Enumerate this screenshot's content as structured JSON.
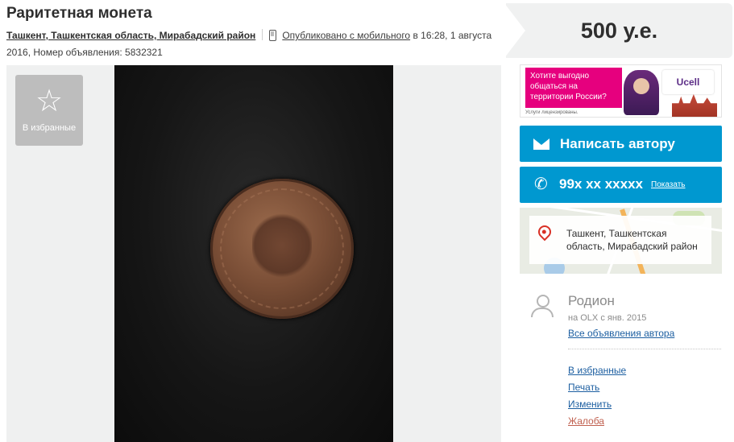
{
  "listing": {
    "title": "Раритетная монета",
    "location": "Ташкент, Ташкентская область, Мирабадский район",
    "published_mobile": "Опубликовано с мобильного",
    "published_time": " в 16:28, 1 августа 2016, Номер объявления: 5832321"
  },
  "gallery": {
    "favorite_label": "В избранные",
    "favorite_icon": "star-icon"
  },
  "price": "500 у.е.",
  "ad": {
    "text": "Хотите выгодно общаться на территории России?",
    "footnote": "Услуги лицензированы.",
    "brand": "Ucell",
    "accent": "#e6007e"
  },
  "contact": {
    "write_label": "Написать автору",
    "phone_number": "99x xx xxxxx",
    "phone_show": "Показать",
    "accent": "#0098d0"
  },
  "map": {
    "address": "Ташкент, Ташкентская область, Мирабадский район"
  },
  "seller": {
    "name": "Родион",
    "since": "на OLX с янв. 2015",
    "all_ads": "Все объявления автора"
  },
  "actions": {
    "favorite": "В избранные",
    "print": "Печать",
    "edit": "Изменить",
    "report": "Жалоба"
  }
}
